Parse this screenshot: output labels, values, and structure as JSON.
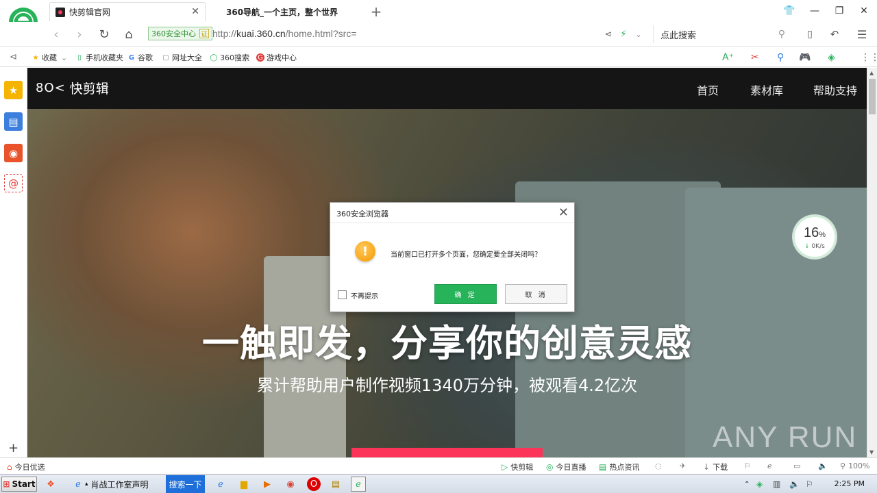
{
  "browser": {
    "tabs": [
      {
        "label": "快剪辑官网",
        "active": true
      },
      {
        "label": "360导航_一个主页，整个世界",
        "active": false
      }
    ],
    "address": {
      "secure_label": "360安全中心",
      "cert_label": "证",
      "url_prefix": "http://",
      "url_host": "kuai.360.cn",
      "url_path": "/home.html?src="
    },
    "search_placeholder": "点此搜索",
    "bookmarks": [
      {
        "label": "收藏",
        "icon": "star-icon"
      },
      {
        "label": "手机收藏夹",
        "icon": "phone-icon"
      },
      {
        "label": "谷歌",
        "icon": "google-icon"
      },
      {
        "label": "网址大全",
        "icon": "page-icon"
      },
      {
        "label": "360搜索",
        "icon": "360-search-icon"
      },
      {
        "label": "游戏中心",
        "icon": "game-icon"
      }
    ]
  },
  "site": {
    "logo_text": "快剪辑",
    "logo_mark": "8O<",
    "nav": [
      "首页",
      "素材库",
      "帮助支持"
    ],
    "hero_title": "一触即发，分享你的创意灵感",
    "hero_subtitle": "累计帮助用户制作视频1340万分钟，被观看4.2亿次"
  },
  "speed_widget": {
    "percent": "16",
    "percent_sign": "%",
    "rate": "0K/s"
  },
  "dialog": {
    "title": "360安全浏览器",
    "message": "当前窗口已打开多个页面，您确定要全部关闭吗？",
    "checkbox_label": "不再提示",
    "ok_label": "确 定",
    "cancel_label": "取 消"
  },
  "statusbar": {
    "left": "今日优选",
    "items": [
      "快剪辑",
      "今日直播",
      "热点资讯",
      "下载"
    ],
    "zoom": "100%"
  },
  "taskbar": {
    "start": "Start",
    "items": [
      "肖战工作室声明",
      "搜索一下"
    ],
    "clock": "2:25 PM"
  },
  "watermark": "ANY RUN"
}
